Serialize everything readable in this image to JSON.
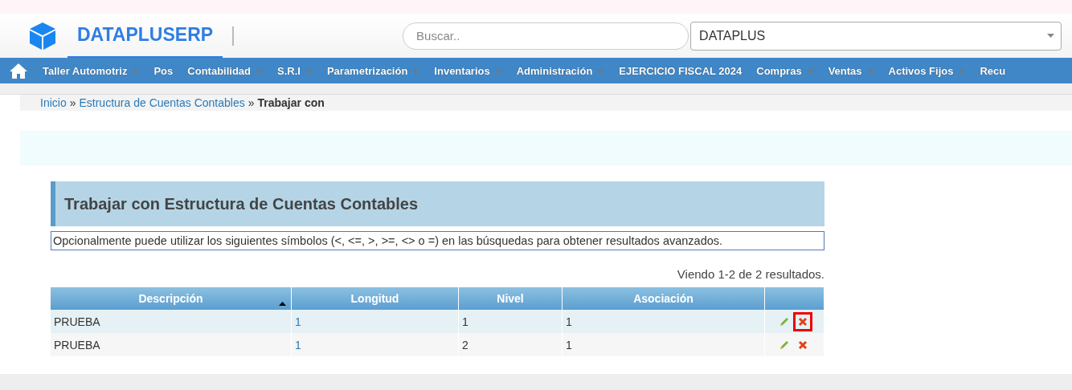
{
  "header": {
    "brand": "DATAPLUSERP",
    "search": {
      "placeholder": "Buscar.."
    },
    "company_select": {
      "value": "DATAPLUS"
    }
  },
  "nav": [
    {
      "label": "Taller Automotriz",
      "dropdown": true
    },
    {
      "label": "Pos",
      "dropdown": false
    },
    {
      "label": "Contabilidad",
      "dropdown": true
    },
    {
      "label": "S.R.I",
      "dropdown": true
    },
    {
      "label": "Parametrización",
      "dropdown": true
    },
    {
      "label": "Inventarios",
      "dropdown": true
    },
    {
      "label": "Administración",
      "dropdown": true
    },
    {
      "label": "EJERCICIO FISCAL 2024",
      "dropdown": false
    },
    {
      "label": "Compras",
      "dropdown": true
    },
    {
      "label": "Ventas",
      "dropdown": true
    },
    {
      "label": "Activos Fijos",
      "dropdown": true
    },
    {
      "label": "Recu",
      "dropdown": false
    }
  ],
  "breadcrumb": {
    "links": [
      "Inicio",
      "Estructura de Cuentas Contables"
    ],
    "separator": "»",
    "current": "Trabajar con"
  },
  "panel_title": "Trabajar con Estructura de Cuentas Contables",
  "notice": "Opcionalmente puede utilizar los siguientes símbolos (<, <=, >, >=, <> o =) en las búsquedas para obtener resultados avanzados.",
  "summary": "Viendo 1-2 de 2 resultados.",
  "table": {
    "columns": [
      {
        "label": "Descripción",
        "sorted": true
      },
      {
        "label": "Longitud",
        "sorted": false
      },
      {
        "label": "Nivel",
        "sorted": false
      },
      {
        "label": "Asociación",
        "sorted": false
      }
    ],
    "rows": [
      {
        "cells": [
          "PRUEBA",
          "1",
          "1",
          "1"
        ],
        "delete_highlighted": true
      },
      {
        "cells": [
          "PRUEBA",
          "1",
          "2",
          "1"
        ],
        "delete_highlighted": false
      }
    ]
  }
}
